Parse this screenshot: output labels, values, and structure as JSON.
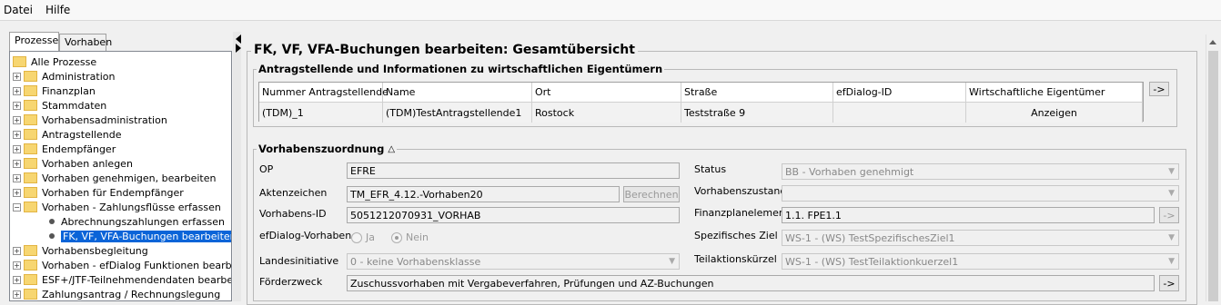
{
  "menubar": {
    "file": "Datei",
    "help": "Hilfe"
  },
  "left_tabs": {
    "processes": "Prozesse",
    "projects": "Vorhaben"
  },
  "tree": {
    "root": "Alle Prozesse",
    "items": [
      {
        "label": "Administration"
      },
      {
        "label": "Finanzplan"
      },
      {
        "label": "Stammdaten"
      },
      {
        "label": "Vorhabensadministration"
      },
      {
        "label": "Antragstellende"
      },
      {
        "label": "Endempfänger"
      },
      {
        "label": "Vorhaben anlegen"
      },
      {
        "label": "Vorhaben genehmigen, bearbeiten"
      },
      {
        "label": "Vorhaben für Endempfänger"
      },
      {
        "label": "Vorhaben - Zahlungsflüsse erfassen"
      },
      {
        "label": "Abrechnungszahlungen erfassen"
      },
      {
        "label": "FK, VF, VFA-Buchungen bearbeiten"
      },
      {
        "label": "Vorhabensbegleitung"
      },
      {
        "label": "Vorhaben - efDialog Funktionen bearbeiten"
      },
      {
        "label": "ESF+/JTF-Teilnehmendendaten bearbeiten"
      },
      {
        "label": "Zahlungsantrag / Rechnungslegung"
      }
    ]
  },
  "main": {
    "title": "FK, VF, VFA-Buchungen bearbeiten: Gesamtübersicht",
    "applicants": {
      "title": "Antragstellende und Informationen zu wirtschaftlichen Eigentümern",
      "columns": [
        "Nummer Antragstellende",
        "Name",
        "Ort",
        "Straße",
        "efDialog-ID",
        "Wirtschaftliche Eigentümer"
      ],
      "row": [
        "(TDM)_1",
        "(TDM)TestAntragstellende1",
        "Rostock",
        "Teststraße 9",
        "",
        "Anzeigen"
      ],
      "nav_button": "->"
    },
    "assignment": {
      "title": "Vorhabenszuordnung",
      "collapse_icon": "triangle-up-icon",
      "op_label": "OP",
      "op_value": "EFRE",
      "file_label": "Aktenzeichen",
      "file_value": "TM_EFR_4.12.-Vorhaben20",
      "calc_button": "Berechnen",
      "id_label": "Vorhabens-ID",
      "id_value": "5051212070931_VORHAB",
      "efdialog_label": "efDialog-Vorhaben",
      "radio_yes": "Ja",
      "radio_no": "Nein",
      "initiative_label": "Landesinitiative",
      "initiative_value": "0 - keine Vorhabensklasse",
      "purpose_label": "Förderzweck",
      "purpose_value": "Zuschussvorhaben mit Vergabeverfahren, Prüfungen und AZ-Buchungen",
      "status_label": "Status",
      "status_value": "BB - Vorhaben genehmigt",
      "state_label": "Vorhabenszustand",
      "state_value": "",
      "finplan_label": "Finanzplanelement",
      "finplan_value": "1.1. FPE1.1",
      "goal_label": "Spezifisches Ziel",
      "goal_value": "WS-1 - (WS) TestSpezifischesZiel1",
      "action_label": "Teilaktionskürzel",
      "action_value": "WS-1 - (WS) TestTeilaktionkuerzel1",
      "arrow_button": "->"
    }
  }
}
